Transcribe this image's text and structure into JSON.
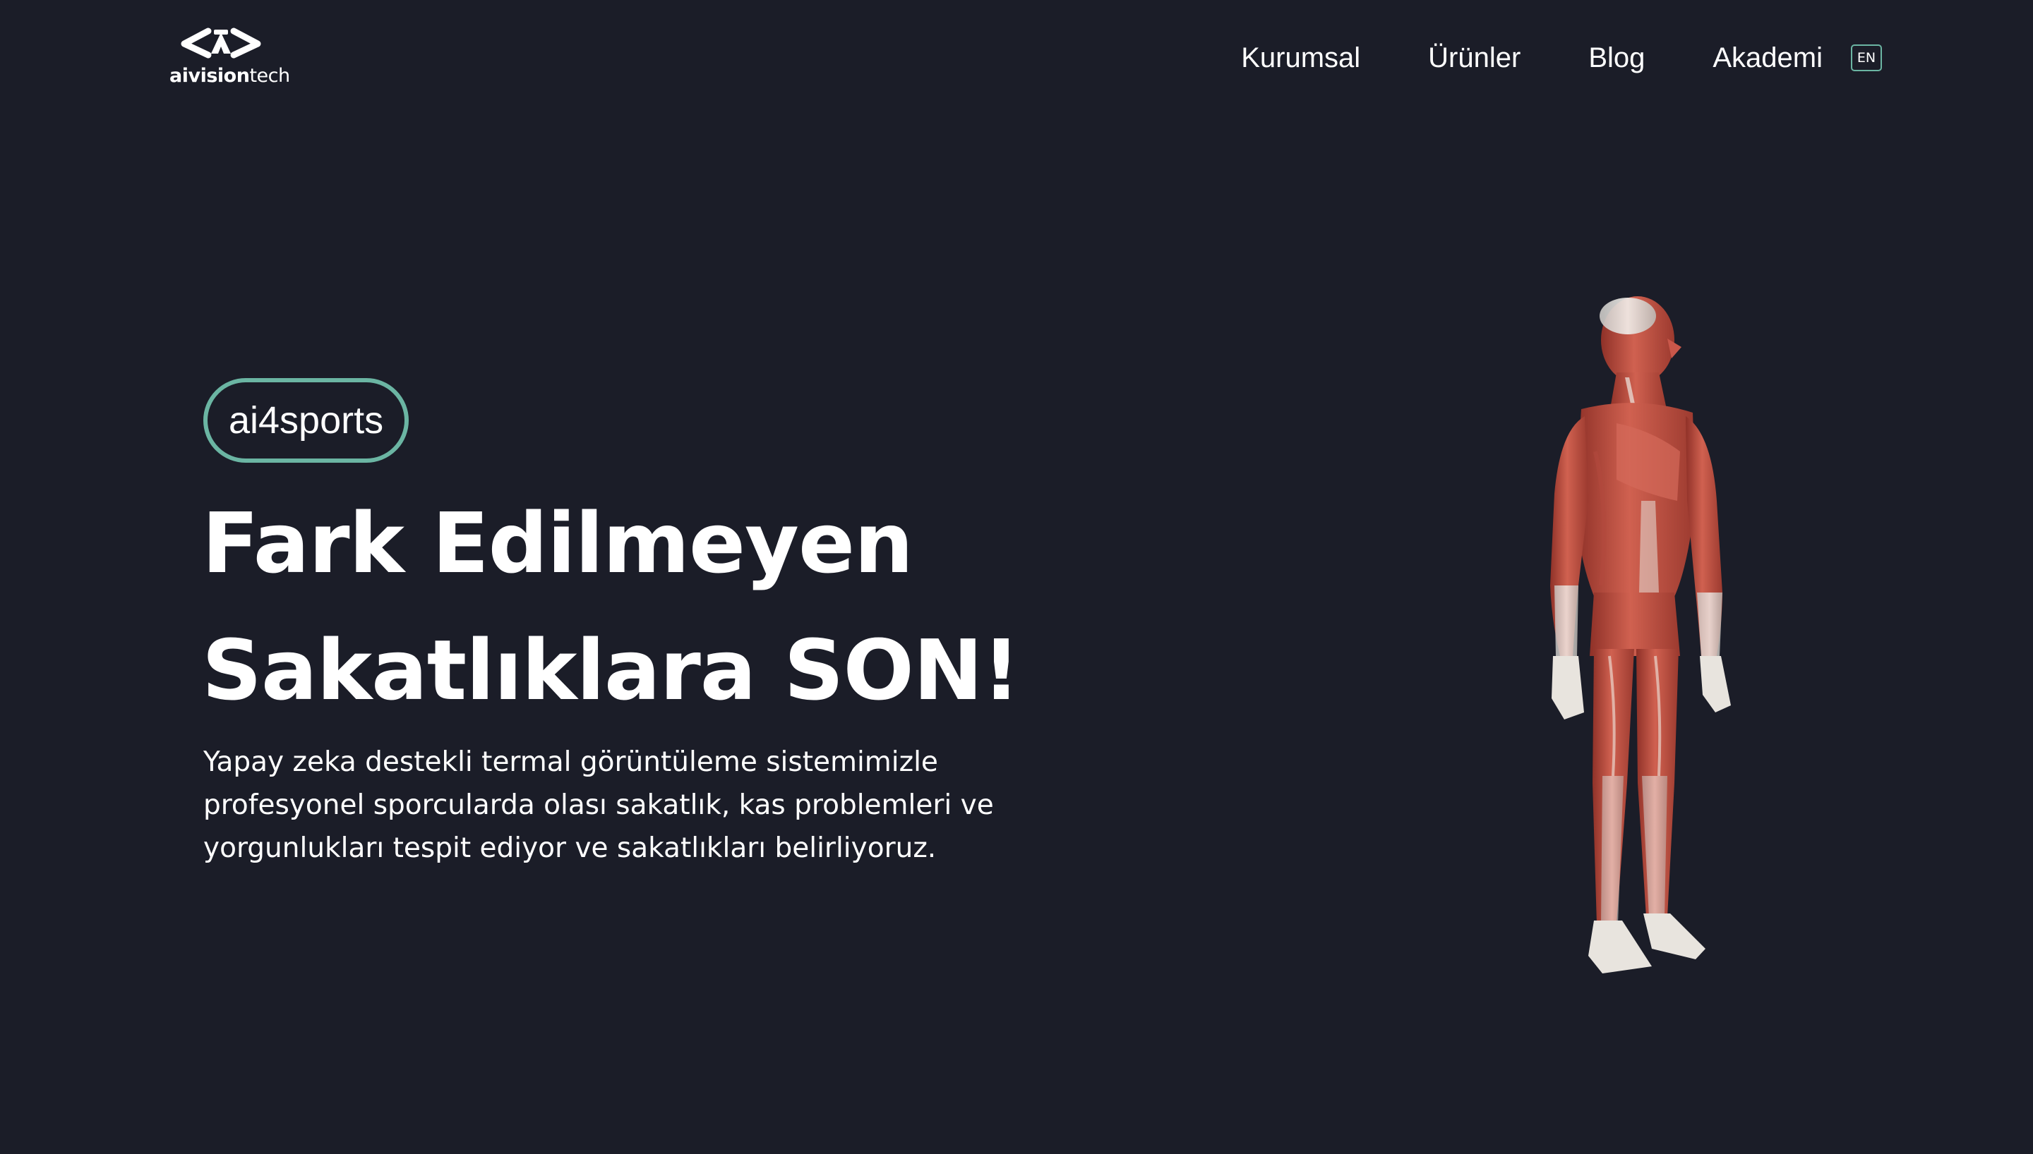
{
  "header": {
    "logo": {
      "text_strong": "aivision",
      "text_light": "tech"
    },
    "nav": [
      {
        "label": "Kurumsal"
      },
      {
        "label": "Ürünler"
      },
      {
        "label": "Blog"
      },
      {
        "label": "Akademi"
      }
    ],
    "language_button": "EN"
  },
  "hero": {
    "tag": "ai4sports",
    "title_line1": "Fark Edilmeyen",
    "title_line2": "Sakatlıklara SON!",
    "description_lines": [
      "Yapay zeka destekli termal görüntüleme sistemimizle",
      "profesyonel sporcularda olası sakatlık, kas problemleri ve",
      "yorgunlukları tespit ediyor ve sakatlıkları belirliyoruz."
    ],
    "image": "human-anatomy-muscle-figure"
  },
  "colors": {
    "background": "#1b1d28",
    "accent": "#6bb5a3",
    "text": "#ffffff",
    "muscle": "#c9574a"
  }
}
